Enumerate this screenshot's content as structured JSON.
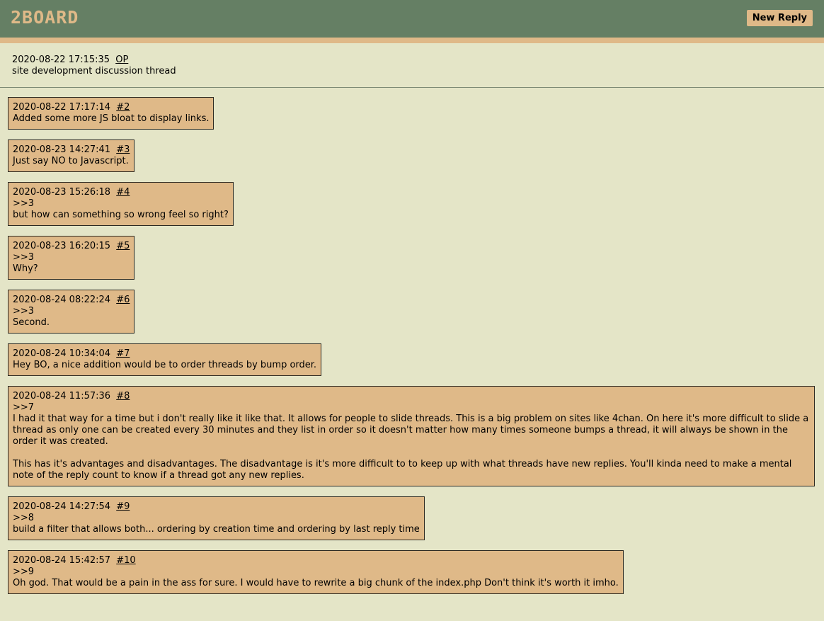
{
  "header": {
    "logo": "2BOARD",
    "new_reply_label": "New Reply"
  },
  "op": {
    "timestamp": "2020-08-22 17:15:35",
    "link": "OP",
    "subject": "site development discussion thread"
  },
  "replies": [
    {
      "timestamp": "2020-08-22 17:17:14",
      "link": "#2",
      "lines": [
        "Added some more JS bloat to display links."
      ]
    },
    {
      "timestamp": "2020-08-23 14:27:41",
      "link": "#3",
      "lines": [
        "Just say NO to Javascript."
      ]
    },
    {
      "timestamp": "2020-08-23 15:26:18",
      "link": "#4",
      "lines": [
        ">>3",
        "but how can something so wrong feel so right?"
      ]
    },
    {
      "timestamp": "2020-08-23 16:20:15",
      "link": "#5",
      "lines": [
        ">>3",
        "Why?"
      ]
    },
    {
      "timestamp": "2020-08-24 08:22:24",
      "link": "#6",
      "lines": [
        ">>3",
        "Second."
      ]
    },
    {
      "timestamp": "2020-08-24 10:34:04",
      "link": "#7",
      "lines": [
        "Hey BO, a nice addition would be to order threads by bump order."
      ]
    },
    {
      "timestamp": "2020-08-24 11:57:36",
      "link": "#8",
      "lines": [
        ">>7",
        "I had it that way for a time but i don't really like it like that. It allows for people to slide threads. This is a big problem on sites like 4chan. On here it's more difficult to slide a thread as only one can be created every 30 minutes and they list in order so it doesn't matter how many times someone bumps a thread, it will always be shown in the order it was created.",
        "This has it's advantages and disadvantages. The disadvantage is it's more difficult to to keep up with what threads have new replies. You'll kinda need to make a mental note of the reply count to know if a thread got any new replies."
      ]
    },
    {
      "timestamp": "2020-08-24 14:27:54",
      "link": "#9",
      "lines": [
        ">>8",
        "build a filter that allows both... ordering by creation time and ordering by last reply time"
      ]
    },
    {
      "timestamp": "2020-08-24 15:42:57",
      "link": "#10",
      "lines": [
        ">>9",
        "Oh god. That would be a pain in the ass for sure. I would have to rewrite a big chunk of the index.php Don't think it's worth it imho."
      ]
    }
  ]
}
